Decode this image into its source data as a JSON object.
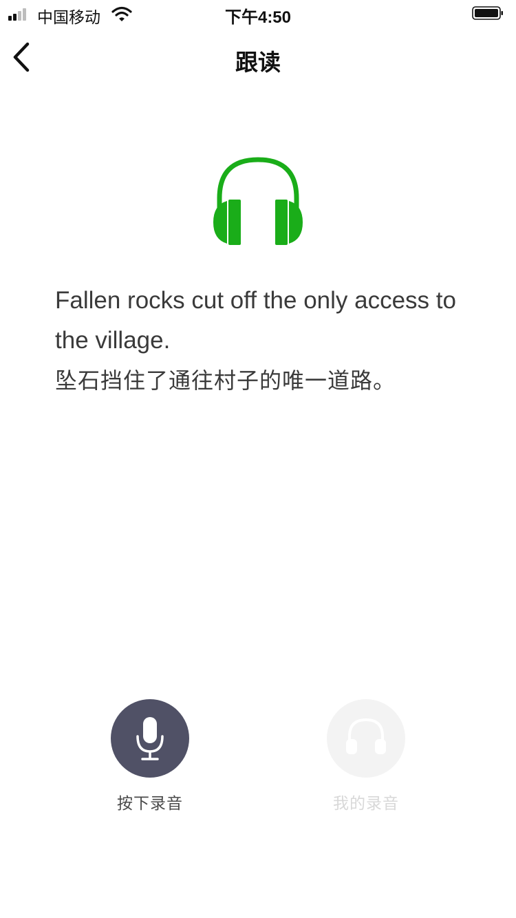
{
  "status_bar": {
    "carrier": "中国移动",
    "time": "下午4:50",
    "icons": [
      "signal-icon",
      "wifi-icon",
      "battery-icon"
    ]
  },
  "nav": {
    "title": "跟读",
    "back_icon": "chevron-left-icon"
  },
  "content": {
    "icon": "headphones-icon",
    "icon_color": "#1aad19",
    "sentence_en": "Fallen rocks cut off the only access to the village.",
    "sentence_zh": "坠石挡住了通往村子的唯一道路。"
  },
  "actions": {
    "record": {
      "label": "按下录音",
      "icon": "microphone-icon",
      "color": "#505166"
    },
    "playback": {
      "label": "我的录音",
      "icon": "headphones-icon",
      "enabled": false
    }
  }
}
